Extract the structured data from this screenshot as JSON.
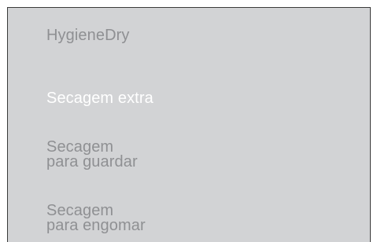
{
  "menu": {
    "items": [
      {
        "label": "HygieneDry",
        "selected": false
      },
      {
        "label": "Secagem extra",
        "selected": true
      },
      {
        "label": "Secagem\npara guardar",
        "selected": false
      },
      {
        "label": "Secagem\npara engomar",
        "selected": false
      }
    ]
  },
  "colors": {
    "panel_background": "#d2d3d5",
    "border": "#3a3a3a",
    "text_dim": "#8f9093",
    "text_selected": "#ffffff"
  }
}
